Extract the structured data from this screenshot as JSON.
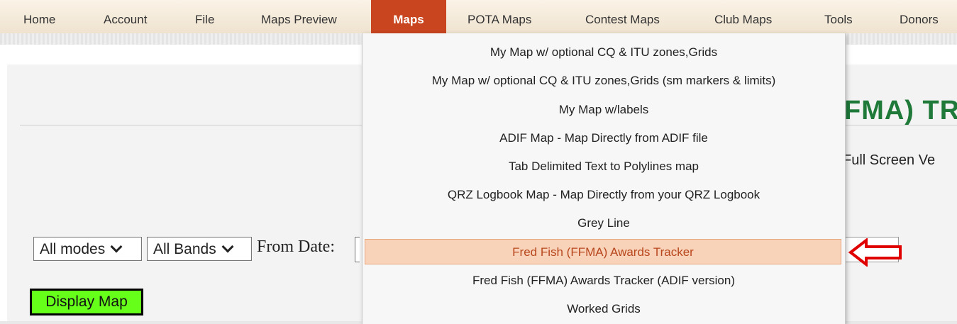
{
  "nav": {
    "items": [
      {
        "label": "Home"
      },
      {
        "label": "Account"
      },
      {
        "label": "File"
      },
      {
        "label": "Maps Preview"
      },
      {
        "label": "Maps",
        "active": true
      },
      {
        "label": "POTA Maps"
      },
      {
        "label": "Contest Maps"
      },
      {
        "label": "Club Maps"
      },
      {
        "label": "Tools"
      },
      {
        "label": "Donors"
      }
    ]
  },
  "page": {
    "title_fragment": "FMA) TRA",
    "full_screen_fragment": "Full Screen Ve",
    "mode_select": "All modes",
    "band_select": "All Bands",
    "from_date_label": "From Date:",
    "display_button": "Display Map"
  },
  "menu": {
    "items": [
      {
        "label": "My Map w/ optional CQ & ITU zones,Grids"
      },
      {
        "label": "My Map w/ optional CQ & ITU zones,Grids (sm markers & limits)"
      },
      {
        "label": "My Map w/labels"
      },
      {
        "label": "ADIF Map - Map Directly from ADIF file"
      },
      {
        "label": "Tab Delimited Text to Polylines map"
      },
      {
        "label": "QRZ Logbook Map - Map Directly from your QRZ Logbook"
      },
      {
        "label": "Grey Line"
      },
      {
        "label": "Fred Fish (FFMA) Awards Tracker",
        "highlighted": true
      },
      {
        "label": "Fred Fish (FFMA) Awards Tracker (ADIF version)"
      },
      {
        "label": "Worked Grids"
      }
    ]
  },
  "colors": {
    "nav_active": "#c9451f",
    "highlight_bg": "#f9d2ba",
    "highlight_text": "#b8471c",
    "title_green": "#1f7a3a",
    "button_green": "#66ff1a",
    "arrow_red": "#e00000"
  }
}
